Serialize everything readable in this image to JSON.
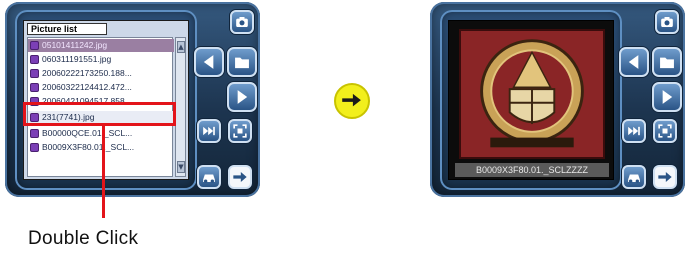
{
  "left_device": {
    "list_title": "Picture list",
    "files": [
      "05101411242.jpg",
      "060311191551.jpg",
      "20060222173250.188...",
      "20060322124412.472...",
      "20060421094517.858...",
      "231(7741).jpg",
      "B00000QCE.01._SCL...",
      "B0009X3F80.01._SCL..."
    ],
    "selected_index": 0,
    "highlighted_index": 5
  },
  "callout": {
    "label": "Double Click",
    "color": "#e3141a"
  },
  "right_device": {
    "caption": "B0009X3F80.01._SCLZZZZ"
  },
  "icons": {
    "camera": "camera-icon",
    "folder": "folder-icon",
    "previous": "arrow-left-icon",
    "next": "arrow-right-icon",
    "fast_forward": "fast-forward-icon",
    "fit": "fit-screen-icon",
    "car": "car-icon",
    "go": "go-arrow-icon"
  },
  "colors": {
    "frame": "#1d3550",
    "highlight": "#e3141a",
    "arrow_badge": "#f2ef1c",
    "selected_row": "#9a7fa2"
  }
}
